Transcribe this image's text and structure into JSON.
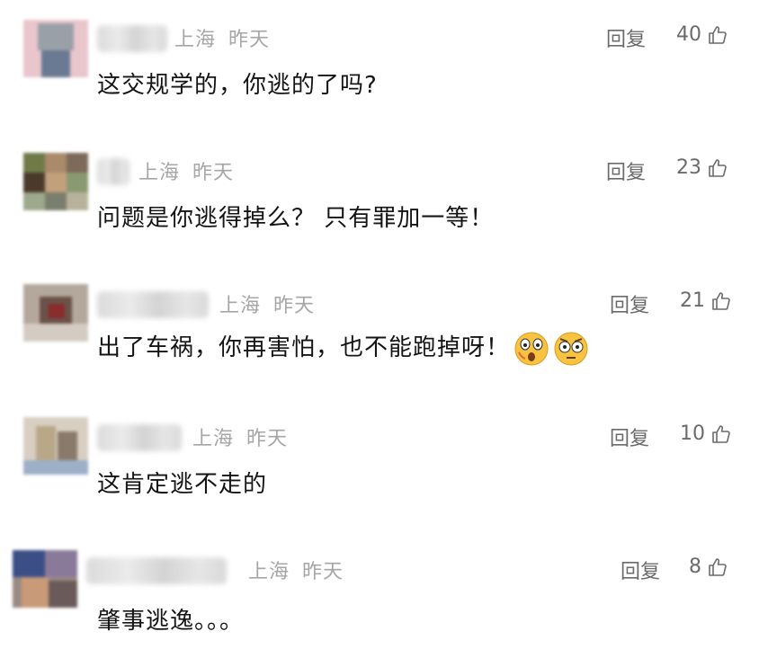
{
  "comments": [
    {
      "location": "上海",
      "time": "昨天",
      "reply_label": "回复",
      "likes": "40",
      "text": "这交规学的，你逃的了吗?"
    },
    {
      "location": "上海",
      "time": "昨天",
      "reply_label": "回复",
      "likes": "23",
      "text": "问题是你逃得掉么？ 只有罪加一等！"
    },
    {
      "location": "上海",
      "time": "昨天",
      "reply_label": "回复",
      "likes": "21",
      "text": "出了车祸，你再害怕，也不能跑掉呀！",
      "emojis": [
        "fearful-face-icon",
        "wide-eyed-face-icon"
      ]
    },
    {
      "location": "上海",
      "time": "昨天",
      "reply_label": "回复",
      "likes": "10",
      "text": "这肯定逃不走的"
    },
    {
      "location": "上海",
      "time": "昨天",
      "reply_label": "回复",
      "likes": "8",
      "text": "肇事逃逸。。。"
    }
  ],
  "icons": {
    "like": "thumbs-up-icon"
  },
  "colors": {
    "meta": "#a6a6a6",
    "reply": "#6b6b6b",
    "text": "#141414"
  }
}
